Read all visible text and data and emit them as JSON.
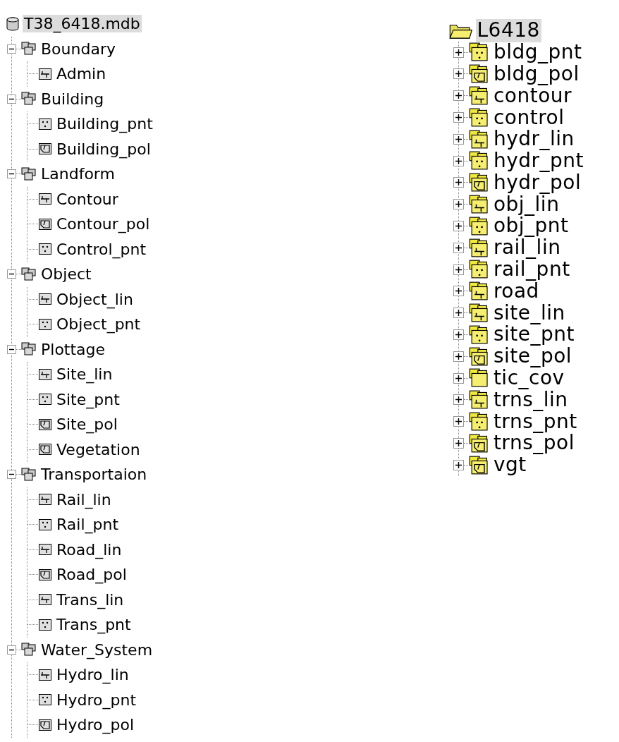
{
  "trees": [
    {
      "root": {
        "label": "T38_6418.mdb",
        "kind": "database",
        "selected": true,
        "children": [
          {
            "label": "Boundary",
            "kind": "dataset",
            "expanded": true,
            "selected": false,
            "children": [
              {
                "label": "Admin",
                "kind": "line",
                "selected": false
              }
            ]
          },
          {
            "label": "Building",
            "kind": "dataset",
            "expanded": true,
            "selected": false,
            "children": [
              {
                "label": "Building_pnt",
                "kind": "point",
                "selected": false
              },
              {
                "label": "Building_pol",
                "kind": "polygon",
                "selected": false
              }
            ]
          },
          {
            "label": "Landform",
            "kind": "dataset",
            "expanded": true,
            "selected": false,
            "children": [
              {
                "label": "Contour",
                "kind": "line",
                "selected": false
              },
              {
                "label": "Contour_pol",
                "kind": "polygon",
                "selected": false
              },
              {
                "label": "Control_pnt",
                "kind": "point",
                "selected": false
              }
            ]
          },
          {
            "label": "Object",
            "kind": "dataset",
            "expanded": true,
            "selected": false,
            "children": [
              {
                "label": "Object_lin",
                "kind": "line",
                "selected": false
              },
              {
                "label": "Object_pnt",
                "kind": "point",
                "selected": false
              }
            ]
          },
          {
            "label": "Plottage",
            "kind": "dataset",
            "expanded": true,
            "selected": false,
            "children": [
              {
                "label": "Site_lin",
                "kind": "line",
                "selected": false
              },
              {
                "label": "Site_pnt",
                "kind": "point",
                "selected": false
              },
              {
                "label": "Site_pol",
                "kind": "polygon",
                "selected": false
              },
              {
                "label": "Vegetation",
                "kind": "polygon",
                "selected": false
              }
            ]
          },
          {
            "label": "Transportaion",
            "kind": "dataset",
            "expanded": true,
            "selected": false,
            "children": [
              {
                "label": "Rail_lin",
                "kind": "line",
                "selected": false
              },
              {
                "label": "Rail_pnt",
                "kind": "point",
                "selected": false
              },
              {
                "label": "Road_lin",
                "kind": "line",
                "selected": false
              },
              {
                "label": "Road_pol",
                "kind": "polygon",
                "selected": false
              },
              {
                "label": "Trans_lin",
                "kind": "line",
                "selected": false
              },
              {
                "label": "Trans_pnt",
                "kind": "point",
                "selected": false
              }
            ]
          },
          {
            "label": "Water_System",
            "kind": "dataset",
            "expanded": true,
            "selected": false,
            "children": [
              {
                "label": "Hydro_lin",
                "kind": "line",
                "selected": false
              },
              {
                "label": "Hydro_pnt",
                "kind": "point",
                "selected": false
              },
              {
                "label": "Hydro_pol",
                "kind": "polygon",
                "selected": false
              }
            ]
          }
        ]
      }
    },
    {
      "root": {
        "label": "L6418",
        "kind": "folder",
        "selected": true,
        "children": [
          {
            "label": "bldg_pnt",
            "kind": "point_coverage",
            "expanded": false,
            "selected": false
          },
          {
            "label": "bldg_pol",
            "kind": "polygon_coverage",
            "expanded": false,
            "selected": false
          },
          {
            "label": "contour",
            "kind": "line_coverage",
            "expanded": false,
            "selected": false
          },
          {
            "label": "control",
            "kind": "point_coverage",
            "expanded": false,
            "selected": false
          },
          {
            "label": "hydr_lin",
            "kind": "line_coverage",
            "expanded": false,
            "selected": false
          },
          {
            "label": "hydr_pnt",
            "kind": "point_coverage",
            "expanded": false,
            "selected": false
          },
          {
            "label": "hydr_pol",
            "kind": "polygon_coverage",
            "expanded": false,
            "selected": false
          },
          {
            "label": "obj_lin",
            "kind": "line_coverage",
            "expanded": false,
            "selected": false
          },
          {
            "label": "obj_pnt",
            "kind": "point_coverage",
            "expanded": false,
            "selected": false
          },
          {
            "label": "rail_lin",
            "kind": "line_coverage",
            "expanded": false,
            "selected": false
          },
          {
            "label": "rail_pnt",
            "kind": "point_coverage",
            "expanded": false,
            "selected": false
          },
          {
            "label": "road",
            "kind": "line_coverage",
            "expanded": false,
            "selected": false
          },
          {
            "label": "site_lin",
            "kind": "line_coverage",
            "expanded": false,
            "selected": false
          },
          {
            "label": "site_pnt",
            "kind": "point_coverage",
            "expanded": false,
            "selected": false
          },
          {
            "label": "site_pol",
            "kind": "polygon_coverage",
            "expanded": false,
            "selected": false
          },
          {
            "label": "tic_cov",
            "kind": "tic_coverage",
            "expanded": false,
            "selected": false
          },
          {
            "label": "trns_lin",
            "kind": "line_coverage",
            "expanded": false,
            "selected": false
          },
          {
            "label": "trns_pnt",
            "kind": "point_coverage",
            "expanded": false,
            "selected": false
          },
          {
            "label": "trns_pol",
            "kind": "polygon_coverage",
            "expanded": false,
            "selected": false
          },
          {
            "label": "vgt",
            "kind": "polygon_coverage",
            "expanded": false,
            "selected": false
          }
        ]
      }
    }
  ]
}
